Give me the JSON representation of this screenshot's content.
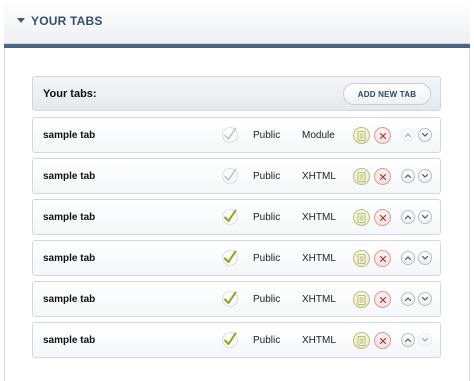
{
  "panel": {
    "title": "YOUR TABS"
  },
  "tabs_bar": {
    "label": "Your tabs:",
    "add_button_label": "ADD NEW TAB"
  },
  "colors": {
    "header_rule": "#4d6384",
    "check_active": "#8aa61a",
    "check_inactive": "#b9bdc2",
    "delete_red": "#c03030"
  },
  "tabs": [
    {
      "name": "sample tab",
      "active": false,
      "visibility": "Public",
      "type": "Module",
      "up_enabled": false,
      "down_enabled": true
    },
    {
      "name": "sample tab",
      "active": false,
      "visibility": "Public",
      "type": "XHTML",
      "up_enabled": true,
      "down_enabled": true
    },
    {
      "name": "sample tab",
      "active": true,
      "visibility": "Public",
      "type": "XHTML",
      "up_enabled": true,
      "down_enabled": true
    },
    {
      "name": "sample tab",
      "active": true,
      "visibility": "Public",
      "type": "XHTML",
      "up_enabled": true,
      "down_enabled": true
    },
    {
      "name": "sample tab",
      "active": true,
      "visibility": "Public",
      "type": "XHTML",
      "up_enabled": true,
      "down_enabled": true
    },
    {
      "name": "sample tab",
      "active": true,
      "visibility": "Public",
      "type": "XHTML",
      "up_enabled": true,
      "down_enabled": false
    }
  ],
  "icons": {
    "collapse": "triangle-down-icon",
    "check": "checkmark-icon",
    "edit": "document-edit-icon",
    "delete": "x-icon",
    "up": "chevron-up-icon",
    "down": "chevron-down-icon"
  }
}
